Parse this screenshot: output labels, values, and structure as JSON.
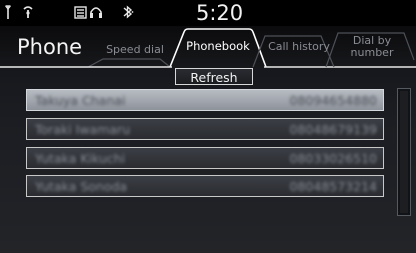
{
  "status_bar": {
    "clock": "5:20",
    "icons": [
      "antenna-signal-icon",
      "phone-icon",
      "phone-battery-icon",
      "headset-icon",
      "bluetooth-icon"
    ]
  },
  "app": {
    "title": "Phone"
  },
  "tabs": [
    {
      "label": "Speed dial",
      "active": false
    },
    {
      "label": "Phonebook",
      "active": true
    },
    {
      "label": "Call history",
      "active": false
    },
    {
      "label_line1": "Dial by",
      "label_line2": "number",
      "active": false
    }
  ],
  "refresh_label": "Refresh",
  "contacts": [
    {
      "name": "Takuya Chanai",
      "number": "08094654880",
      "selected": true
    },
    {
      "name": "Toraki Iwamaru",
      "number": "08048679139",
      "selected": false
    },
    {
      "name": "Yutaka Kikuchi",
      "number": "08033026510",
      "selected": false
    },
    {
      "name": "Yutaka Sonoda",
      "number": "08048573214",
      "selected": false
    }
  ],
  "colors": {
    "background": "#1b1d22",
    "selected_row": "#a9aeb5",
    "active_tab_text": "#ffffff",
    "inactive_tab_text": "#8a8d94"
  }
}
